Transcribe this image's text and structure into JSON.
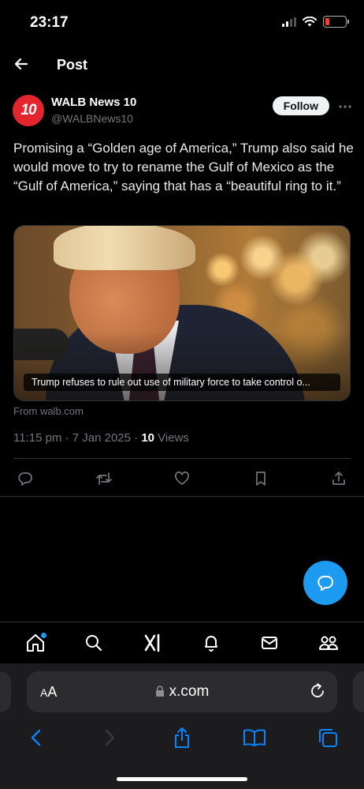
{
  "status_bar": {
    "time": "23:17"
  },
  "topbar": {
    "title": "Post"
  },
  "author": {
    "avatar_text": "10",
    "name": "WALB News 10",
    "handle": "@WALBNews10",
    "follow_label": "Follow"
  },
  "tweet": {
    "text": "Promising a “Golden age of America,” Trump also said he would move to try to rename the Gulf of Mexico as the “Gulf of America,” saying that has a “beautiful ring to it.”",
    "card_caption": "Trump refuses to rule out use of military force to take control o...",
    "source": "From walb.com",
    "timestamp": "11:15 pm · 7 Jan 2025 · ",
    "views_count": "10",
    "views_label": " Views"
  },
  "browser": {
    "aa_big": "A",
    "aa_small": "A",
    "url": "x.com"
  },
  "colors": {
    "accent": "#1d9bf0",
    "follow_bg": "#eff3f4",
    "avatar_red": "#e3262d"
  },
  "icons": {
    "actions": [
      "reply-icon",
      "repost-icon",
      "like-icon",
      "bookmark-icon",
      "share-icon"
    ],
    "nav": [
      "home-icon",
      "search-icon",
      "grok-icon",
      "notifications-icon",
      "messages-icon",
      "communities-icon"
    ]
  }
}
